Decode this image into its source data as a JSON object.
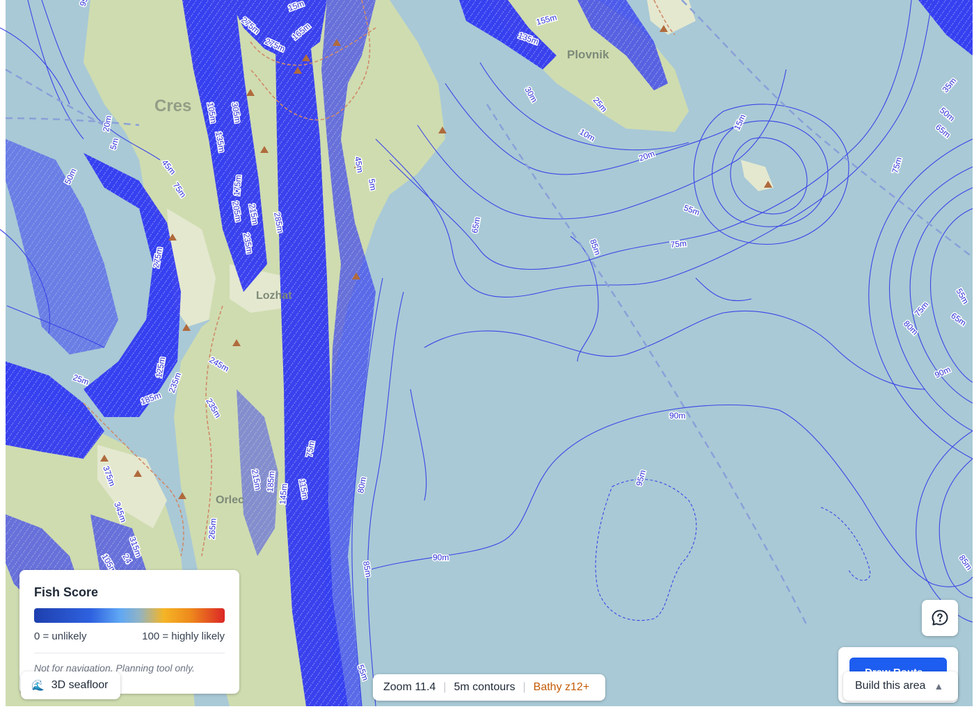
{
  "map": {
    "colors": {
      "water": "#a9c9d6",
      "land": "#cfdcb0",
      "land_light": "#e4e8cf",
      "contour": "#3a45e6",
      "hotspot": "#2b2ff0",
      "road": "#d08a68",
      "boundary": "#8aa0d8"
    },
    "place_labels": [
      "Cres",
      "Plovnik",
      "Lozhat",
      "Orlec"
    ],
    "contour_labels": [
      "95m",
      "15m",
      "275m",
      "275m",
      "165m",
      "155m",
      "135m",
      "20m",
      "5m",
      "50m",
      "45m",
      "75m",
      "105m",
      "305m",
      "135m",
      "175m",
      "205m",
      "215m",
      "285m",
      "235m",
      "45m",
      "5m",
      "65m",
      "30m",
      "25m",
      "10m",
      "20m",
      "15m",
      "55m",
      "75m",
      "85m",
      "35m",
      "50m",
      "65m",
      "75m",
      "55m",
      "75m",
      "65m",
      "80m",
      "90m",
      "275m",
      "245m",
      "125m",
      "235m",
      "25m",
      "185m",
      "235m",
      "375m",
      "345m",
      "315m",
      "105m",
      "24",
      "215m",
      "185m",
      "145m",
      "115m",
      "75m",
      "80m",
      "85m",
      "265m",
      "90m",
      "90m",
      "95m",
      "85m",
      "55m"
    ]
  },
  "legend": {
    "title": "Fish Score",
    "min_label": "0 = unlikely",
    "max_label": "100 = highly likely",
    "note": "Not for navigation. Planning tool only.",
    "gradient_colors": [
      "#1e3fae",
      "#2f62e0",
      "#5fa7f4",
      "#8fb3c6",
      "#f5b526",
      "#ee8a1c",
      "#dc2626"
    ]
  },
  "controls": {
    "seafloor_icon": "wave-icon",
    "seafloor_label": "3D seafloor",
    "help_icon": "help-chat-icon",
    "primary_label": "Draw Route",
    "build_label": "Build this area",
    "build_caret_icon": "caret-up-icon"
  },
  "status": {
    "zoom": "Zoom 11.4",
    "contours": "5m contours",
    "bathy": "Bathy z12+"
  }
}
